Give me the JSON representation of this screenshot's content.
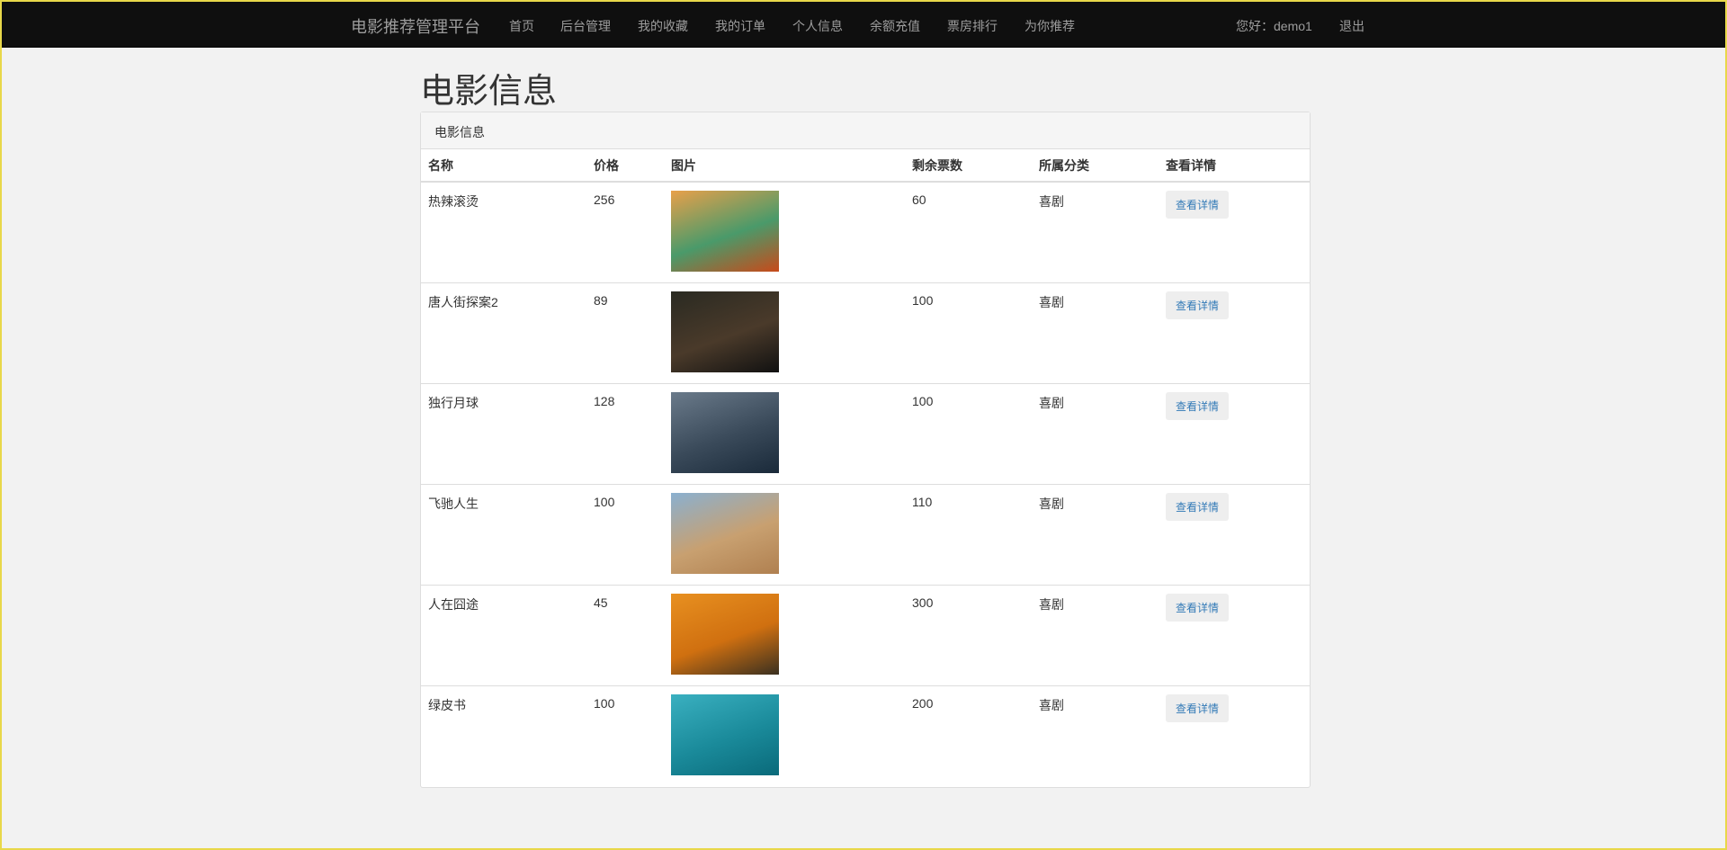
{
  "nav": {
    "brand": "电影推荐管理平台",
    "links": [
      "首页",
      "后台管理",
      "我的收藏",
      "我的订单",
      "个人信息",
      "余额充值",
      "票房排行",
      "为你推荐"
    ],
    "greeting": "您好：demo1",
    "logout": "退出"
  },
  "page_title": "电影信息",
  "panel_heading": "电影信息",
  "table": {
    "headers": [
      "名称",
      "价格",
      "图片",
      "剩余票数",
      "所属分类",
      "查看详情"
    ],
    "rows": [
      {
        "name": "热辣滚烫",
        "price": "256",
        "tickets": "60",
        "category": "喜剧",
        "detail": "查看详情",
        "poster_colors": [
          "#e8a04a",
          "#4a9a6a",
          "#c84a1a"
        ]
      },
      {
        "name": "唐人街探案2",
        "price": "89",
        "tickets": "100",
        "category": "喜剧",
        "detail": "查看详情",
        "poster_colors": [
          "#2a2a22",
          "#4a3a2a",
          "#111111"
        ]
      },
      {
        "name": "独行月球",
        "price": "128",
        "tickets": "100",
        "category": "喜剧",
        "detail": "查看详情",
        "poster_colors": [
          "#6a7a8a",
          "#3a4a5a",
          "#1a2a3a"
        ]
      },
      {
        "name": "飞驰人生",
        "price": "100",
        "tickets": "110",
        "category": "喜剧",
        "detail": "查看详情",
        "poster_colors": [
          "#8ab0d0",
          "#c8a070",
          "#b08050"
        ]
      },
      {
        "name": "人在囧途",
        "price": "45",
        "tickets": "300",
        "category": "喜剧",
        "detail": "查看详情",
        "poster_colors": [
          "#e89020",
          "#d07010",
          "#3a3020"
        ]
      },
      {
        "name": "绿皮书",
        "price": "100",
        "tickets": "200",
        "category": "喜剧",
        "detail": "查看详情",
        "poster_colors": [
          "#3ab0c0",
          "#1a8a9a",
          "#0a6a7a"
        ]
      }
    ]
  }
}
